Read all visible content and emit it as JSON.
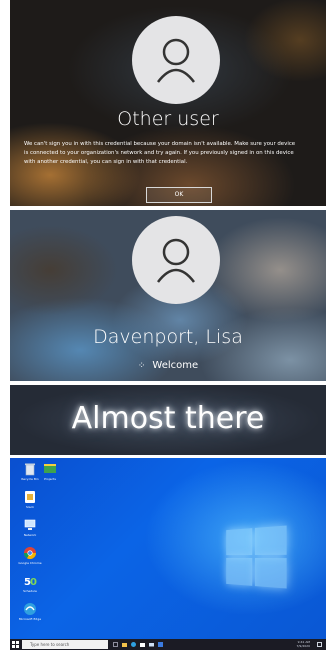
{
  "screen1": {
    "title": "Other user",
    "message_line1": "We can't sign you in with this credential because your domain isn't available. Make sure your device",
    "message_line2": "is connected to your organization's network and try again. If you previously signed in on this device",
    "message_line3": "with another credential, you can sign in with that credential.",
    "ok_label": "OK"
  },
  "screen2": {
    "user_name": "Davenport, Lisa",
    "status": "Welcome"
  },
  "screen3": {
    "text": "Almost there"
  },
  "desktop": {
    "icons": [
      {
        "label": "Recycle Bin",
        "icon": "recycle-bin-icon"
      },
      {
        "label": "Projects",
        "icon": "projects-icon"
      },
      {
        "label": "Slack",
        "icon": "slack-icon"
      },
      {
        "label": "Network",
        "icon": "network-icon"
      },
      {
        "label": "Google Chrome",
        "icon": "chrome-icon"
      },
      {
        "label": "Schedule",
        "icon": "schedule-icon"
      },
      {
        "label": "Microsoft Edge",
        "icon": "edge-icon"
      }
    ],
    "taskbar": {
      "search_placeholder": "Type here to search",
      "time": "9:41 AM",
      "date": "7/9/2020"
    },
    "colors": {
      "desktop_blue": "#0b5fe0",
      "taskbar": "#1b1b24"
    }
  }
}
